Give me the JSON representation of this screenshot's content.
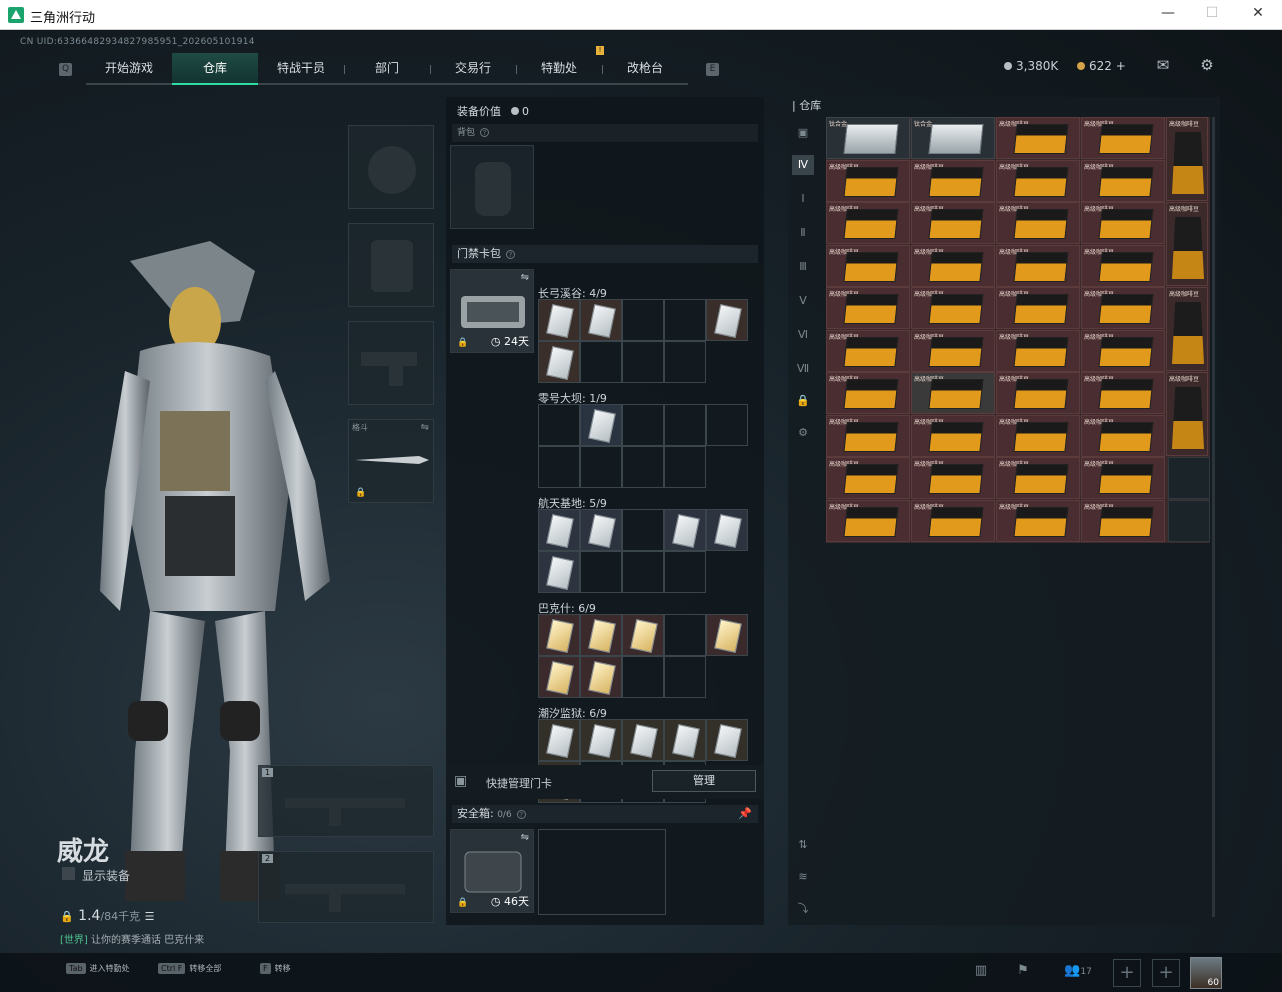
{
  "window": {
    "title": "三角洲行动",
    "icon": "delta-logo-icon"
  },
  "uid": "CN UID:6336648293482798595​1_202605101914",
  "nav": {
    "tabs": [
      "开始游戏",
      "仓库",
      "特战干员",
      "部门",
      "交易行",
      "特勤处",
      "改枪台"
    ],
    "active": 1,
    "left_key": "Q",
    "right_key": "E",
    "badge": "!"
  },
  "currency": {
    "coins": "3,380K",
    "bonds": "622",
    "plus": "+"
  },
  "character": {
    "name": "威龙",
    "show_equipment": "显示装备",
    "weight": "1.4",
    "weight_max": "/84千克",
    "chat_channel": "[世界]",
    "chat_msg": "让你的赛季通话 巴克什来"
  },
  "slots": {
    "melee_label": "格斗",
    "weapon1": "1",
    "weapon2": "2"
  },
  "middle": {
    "gear_value_label": "装备价值",
    "gear_value": "0",
    "backpack_label": "背包",
    "keycard_label": "门禁卡包",
    "keycard_days": "24天",
    "groups": [
      {
        "name": "长弓溪谷: 4/9"
      },
      {
        "name": "零号大坝: 1/9"
      },
      {
        "name": "航天基地: 5/9"
      },
      {
        "name": "巴克什: 6/9"
      },
      {
        "name": "潮汐监狱: 6/9"
      }
    ],
    "quick_label": "快捷管理门卡",
    "manage_label": "管理",
    "safebox_label": "安全箱: ",
    "safebox_count": "0/6",
    "safebox_days": "46天"
  },
  "stash": {
    "title": "仓库",
    "item_label": "高级咖啡豆",
    "silver_label": "钛合金",
    "bag_label": "高级咖啡豆"
  },
  "bottom": {
    "hints": [
      {
        "key": "Tab",
        "label": "进入特勤处"
      },
      {
        "key": "Ctrl F",
        "label": "转移全部"
      },
      {
        "key": "F",
        "label": "转移"
      }
    ],
    "friends": "17",
    "level": "60"
  }
}
